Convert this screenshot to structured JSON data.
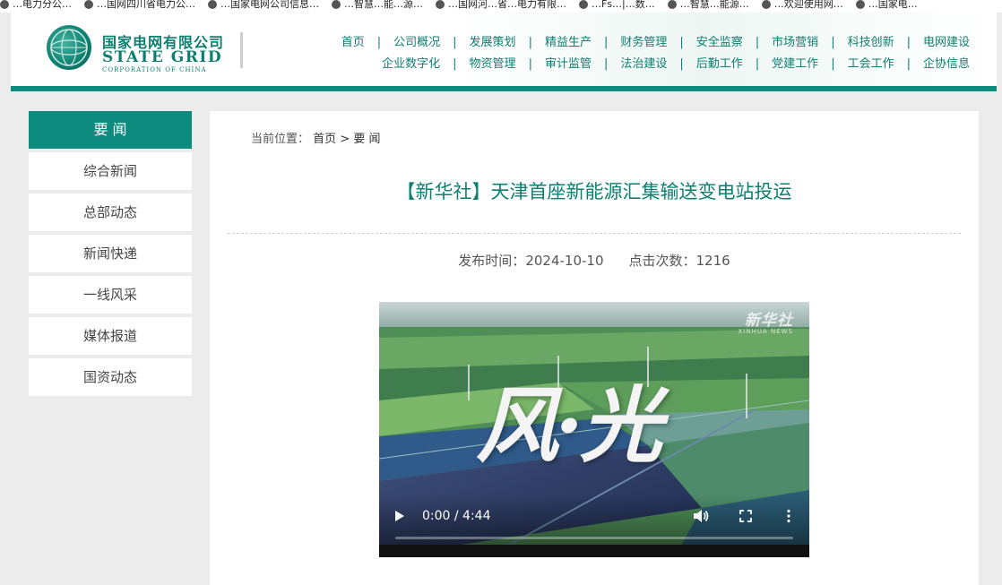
{
  "bookmarks": [
    "…电力分公…",
    "…国网四川省电力公…",
    "…国家电网公司信息…",
    "…智慧…能…源…",
    "…国网河…省…电力有限…",
    "…Fs…|…数…",
    "…智慧…能源…",
    "…欢迎使用网…",
    "…国家电…"
  ],
  "header": {
    "logo_cn": "国家电网有限公司",
    "logo_en": "STATE GRID",
    "logo_sub": "CORPORATION OF CHINA",
    "nav_row1": [
      "首页",
      "公司概况",
      "发展策划",
      "精益生产",
      "财务管理",
      "安全监察",
      "市场营销",
      "科技创新",
      "电网建设"
    ],
    "nav_row2": [
      "企业数字化",
      "物资管理",
      "审计监管",
      "法治建设",
      "后勤工作",
      "党建工作",
      "工会工作",
      "企协信息"
    ],
    "separator": "|"
  },
  "sidebar": {
    "title": "要 闻",
    "items": [
      {
        "label": "综合新闻"
      },
      {
        "label": "总部动态"
      },
      {
        "label": "新闻快递"
      },
      {
        "label": "一线风采"
      },
      {
        "label": "媒体报道"
      },
      {
        "label": "国资动态"
      }
    ]
  },
  "breadcrumb": {
    "label": "当前位置：",
    "home": "首页",
    "separator": ">",
    "current": "要 闻"
  },
  "article": {
    "title": "【新华社】天津首座新能源汇集输送变电站投运",
    "publish_label": "发布时间：",
    "publish_date": "2024-10-10",
    "clicks_label": "点击次数：",
    "clicks": "1216"
  },
  "video": {
    "watermark_cn": "新华社",
    "watermark_en": "XINHUA NEWS",
    "calligraphy": "风·光",
    "time": "0:00 / 4:44",
    "progress": 0
  },
  "colors": {
    "brand": "#0d8b7e",
    "brand_text": "#0d7f70"
  }
}
